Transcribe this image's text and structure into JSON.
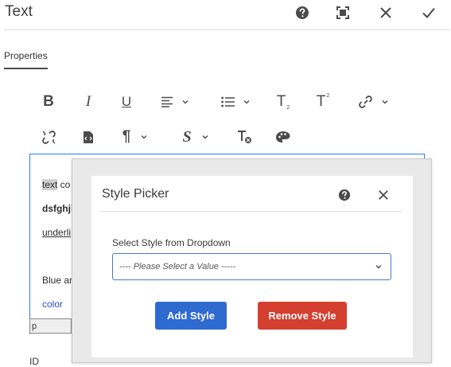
{
  "dialog": {
    "title": "Text",
    "icons": [
      "help-icon",
      "fullscreen-icon",
      "close-icon",
      "done-icon"
    ]
  },
  "tabs": [
    {
      "label": "Properties",
      "active": true
    }
  ],
  "toolbar": {
    "row1": [
      "bold",
      "italic",
      "underline",
      "justify",
      "list",
      "subscript",
      "superscript",
      "link"
    ],
    "row2": [
      "unlink",
      "paste-as-text",
      "paragraph-format",
      "styles",
      "clear-format",
      "style-picker"
    ],
    "glyphs": {
      "bold": "B",
      "italic": "I",
      "underline": "U",
      "subscript_base": "T",
      "subscript_mark": "2",
      "superscript_base": "T",
      "superscript_mark": "2",
      "paragraph": "¶",
      "styles": "S"
    }
  },
  "editor": {
    "line1_highlight": "text",
    "line1_rest": " co",
    "line2": "dsfghjk",
    "line3": "underli",
    "line4": "Blue ar",
    "line5": "color",
    "status": "p"
  },
  "form": {
    "id_label": "ID"
  },
  "style_picker": {
    "title": "Style Picker",
    "select_label": "Select Style from Dropdown",
    "select_placeholder": "---- Please Select a Value -----",
    "add_button": "Add Style",
    "remove_button": "Remove Style"
  },
  "colors": {
    "accent": "#2680eb",
    "add_button": "#2f6ad1",
    "remove_button": "#d43f2f",
    "link_text": "#2b4cc4"
  }
}
